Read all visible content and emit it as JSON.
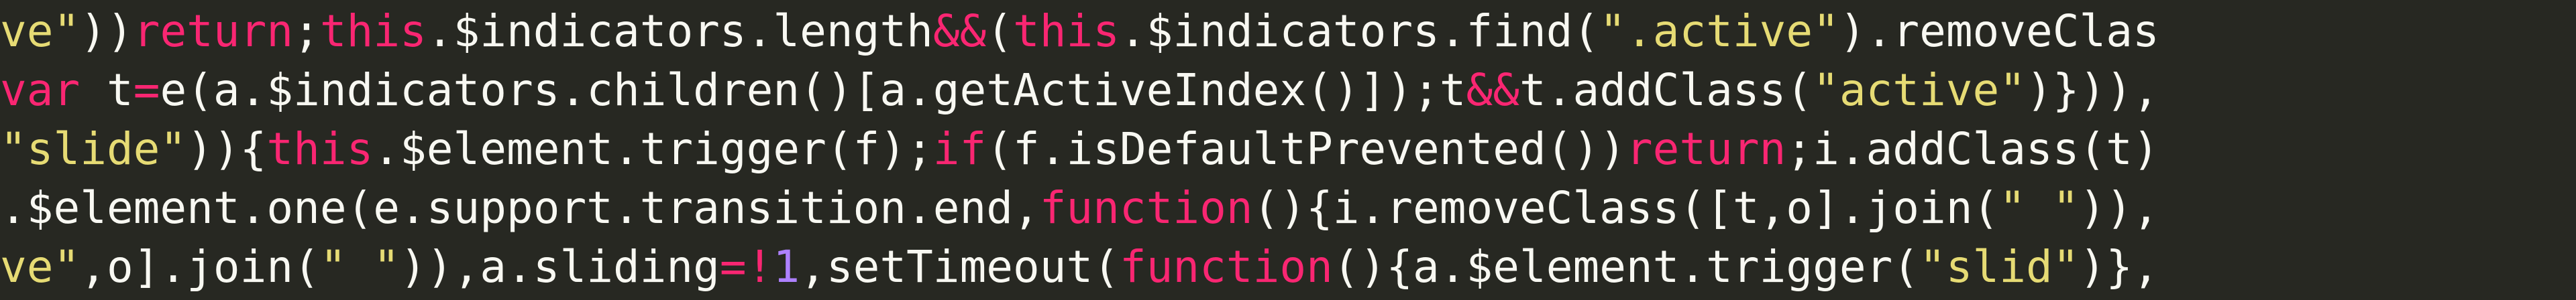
{
  "theme": {
    "background": "#272822",
    "default": "#f8f8f2",
    "keyword": "#f92672",
    "string": "#e6db74",
    "number": "#ae81ff"
  },
  "code": {
    "lines": [
      {
        "tokens": [
          {
            "t": "ve\"",
            "k": "string"
          },
          {
            "t": "))",
            "k": "default"
          },
          {
            "t": "return",
            "k": "keyword"
          },
          {
            "t": ";",
            "k": "default"
          },
          {
            "t": "this",
            "k": "keyword"
          },
          {
            "t": ".$indicators.length",
            "k": "default"
          },
          {
            "t": "&&",
            "k": "keyword"
          },
          {
            "t": "(",
            "k": "default"
          },
          {
            "t": "this",
            "k": "keyword"
          },
          {
            "t": ".$indicators.find(",
            "k": "default"
          },
          {
            "t": "\".active\"",
            "k": "string"
          },
          {
            "t": ").removeClas",
            "k": "default"
          }
        ]
      },
      {
        "tokens": [
          {
            "t": "var",
            "k": "keyword"
          },
          {
            "t": " t",
            "k": "default"
          },
          {
            "t": "=",
            "k": "keyword"
          },
          {
            "t": "e(a.$indicators.children()[a.getActiveIndex()]);t",
            "k": "default"
          },
          {
            "t": "&&",
            "k": "keyword"
          },
          {
            "t": "t.addClass(",
            "k": "default"
          },
          {
            "t": "\"active\"",
            "k": "string"
          },
          {
            "t": ")})),",
            "k": "default"
          }
        ]
      },
      {
        "tokens": [
          {
            "t": "\"slide\"",
            "k": "string"
          },
          {
            "t": ")){",
            "k": "default"
          },
          {
            "t": "this",
            "k": "keyword"
          },
          {
            "t": ".$element.trigger(f);",
            "k": "default"
          },
          {
            "t": "if",
            "k": "keyword"
          },
          {
            "t": "(f.isDefaultPrevented())",
            "k": "default"
          },
          {
            "t": "return",
            "k": "keyword"
          },
          {
            "t": ";i.addClass(t)",
            "k": "default"
          }
        ]
      },
      {
        "tokens": [
          {
            "t": ".$element.one(e.support.transition.end,",
            "k": "default"
          },
          {
            "t": "function",
            "k": "keyword"
          },
          {
            "t": "(){i.removeClass([t,o].join(",
            "k": "default"
          },
          {
            "t": "\" \"",
            "k": "string"
          },
          {
            "t": ")),",
            "k": "default"
          }
        ]
      },
      {
        "tokens": [
          {
            "t": "ve\"",
            "k": "string"
          },
          {
            "t": ",o].join(",
            "k": "default"
          },
          {
            "t": "\" \"",
            "k": "string"
          },
          {
            "t": ")),a.sliding",
            "k": "default"
          },
          {
            "t": "=!",
            "k": "keyword"
          },
          {
            "t": "1",
            "k": "number"
          },
          {
            "t": ",setTimeout(",
            "k": "default"
          },
          {
            "t": "function",
            "k": "keyword"
          },
          {
            "t": "(){a.$element.trigger(",
            "k": "default"
          },
          {
            "t": "\"slid\"",
            "k": "string"
          },
          {
            "t": ")},",
            "k": "default"
          }
        ]
      }
    ]
  }
}
